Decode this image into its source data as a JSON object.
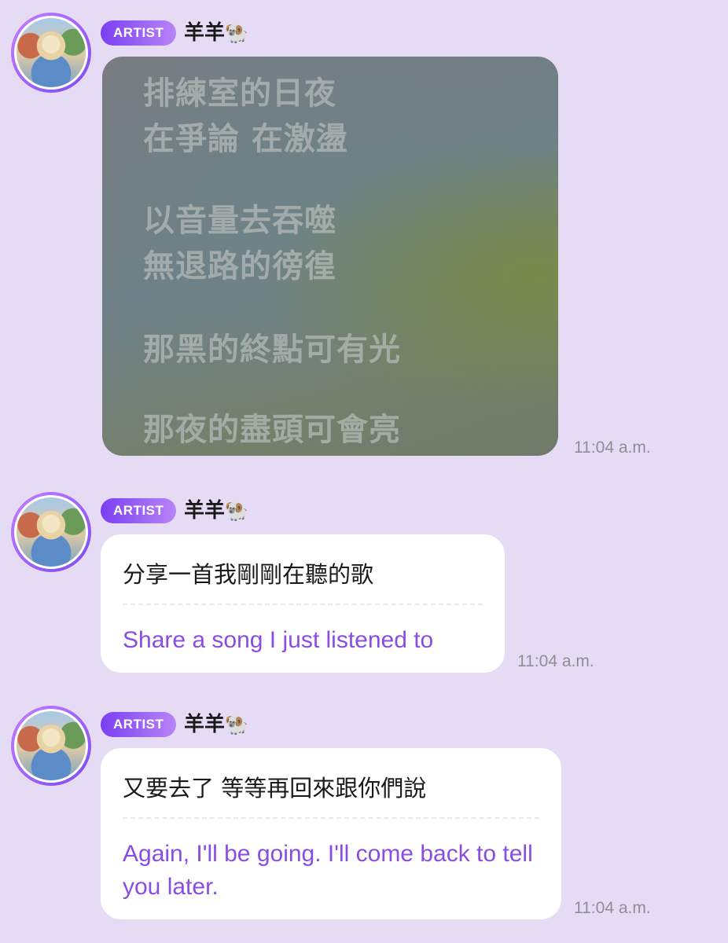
{
  "messages": [
    {
      "badge": "ARTIST",
      "username": "羊羊",
      "username_emoji": "🐏",
      "image_lyrics": [
        "排練室的日夜",
        "在爭論 在激盪",
        "以音量去吞噬",
        "無退路的徬徨",
        "那黑的終點可有光",
        "那夜的盡頭可會亮"
      ],
      "time": "11:04 a.m."
    },
    {
      "badge": "ARTIST",
      "username": "羊羊",
      "username_emoji": "🐏",
      "original": "分享一首我剛剛在聽的歌",
      "translation": "Share a song I just listened to",
      "time": "11:04 a.m."
    },
    {
      "badge": "ARTIST",
      "username": "羊羊",
      "username_emoji": "🐏",
      "original": "又要去了 等等再回來跟你們說",
      "translation": "Again, I'll be going. I'll come back to tell you later.",
      "time": "11:04 a.m."
    }
  ]
}
